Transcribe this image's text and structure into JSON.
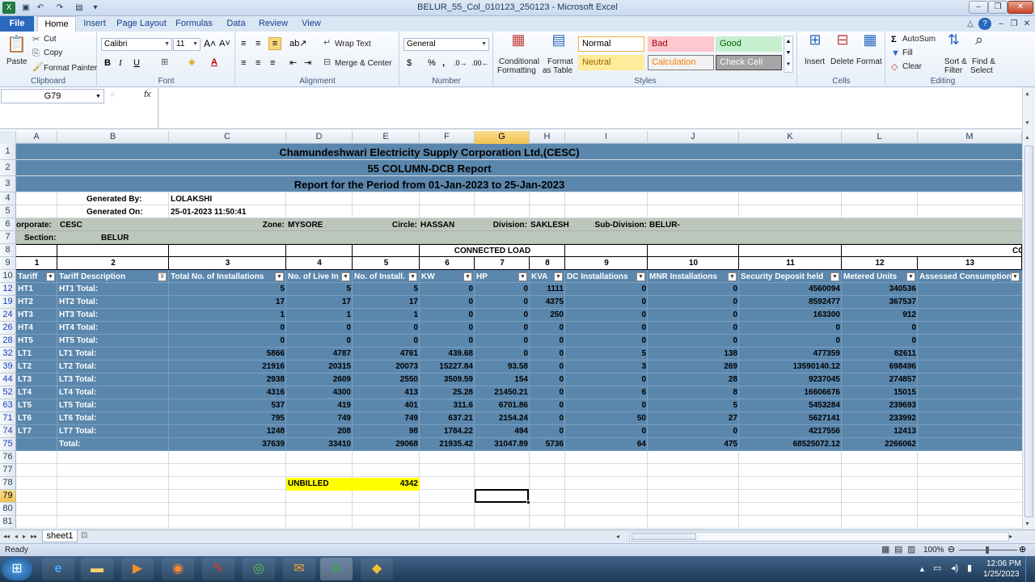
{
  "window": {
    "title": "BELUR_55_Col_010123_250123 - Microsoft Excel"
  },
  "tabs": [
    "File",
    "Home",
    "Insert",
    "Page Layout",
    "Formulas",
    "Data",
    "Review",
    "View"
  ],
  "ribbon": {
    "clipboard": {
      "paste": "Paste",
      "cut": "Cut",
      "copy": "Copy",
      "format_painter": "Format Painter",
      "label": "Clipboard"
    },
    "font": {
      "name": "Calibri",
      "size": "11",
      "label": "Font",
      "bold": "B",
      "italic": "I",
      "underline": "U"
    },
    "alignment": {
      "wrap": "Wrap Text",
      "merge": "Merge & Center",
      "label": "Alignment"
    },
    "number": {
      "format": "General",
      "label": "Number",
      "currency": "$",
      "percent": "%",
      "comma": ","
    },
    "styles": {
      "conditional": "Conditional",
      "conditional2": "Formatting",
      "format_table": "Format",
      "format_table2": "as Table",
      "label": "Styles",
      "cells": [
        {
          "name": "Normal",
          "bg": "#ffffff",
          "fg": "#000000",
          "border": "#f5b041"
        },
        {
          "name": "Bad",
          "bg": "#ffc7ce",
          "fg": "#9c0006",
          "border": "#ffc7ce"
        },
        {
          "name": "Good",
          "bg": "#c6efce",
          "fg": "#006100",
          "border": "#c6efce"
        },
        {
          "name": "Neutral",
          "bg": "#ffeb9c",
          "fg": "#9c6500",
          "border": "#ffeb9c"
        },
        {
          "name": "Calculation",
          "bg": "#f2f2f2",
          "fg": "#fa7d00",
          "border": "#7f7f7f"
        },
        {
          "name": "Check Cell",
          "bg": "#a5a5a5",
          "fg": "#ffffff",
          "border": "#3f3f3f"
        }
      ]
    },
    "cells": {
      "insert": "Insert",
      "delete": "Delete",
      "format": "Format",
      "label": "Cells"
    },
    "editing": {
      "autosum": "AutoSum",
      "fill": "Fill",
      "clear": "Clear",
      "sort": "Sort &",
      "sort2": "Filter",
      "find": "Find &",
      "find2": "Select",
      "label": "Editing"
    }
  },
  "formula_bar": {
    "name_box": "G79",
    "fx": "fx",
    "value": ""
  },
  "columns": [
    "A",
    "B",
    "C",
    "D",
    "E",
    "F",
    "G",
    "H",
    "I",
    "J",
    "K",
    "L",
    "M"
  ],
  "selected_column": "G",
  "selected_row": "79",
  "report": {
    "title1": "Chamundeshwari Electricity Supply Corporation Ltd,(CESC)",
    "title2": "55 COLUMN-DCB Report",
    "title3": "Report for the Period from 01-Jan-2023 to 25-Jan-2023",
    "generated_by_label": "Generated By:",
    "generated_by": "LOLAKSHI",
    "generated_on_label": "Generated On:",
    "generated_on": "25-01-2023 11:50:41",
    "corporate_label": "orporate:",
    "corporate": "CESC",
    "zone_label": "Zone:",
    "zone": "MYSORE",
    "circle_label": "Circle:",
    "circle": "HASSAN",
    "division_label": "Division:",
    "division": "SAKLESH",
    "subdiv_label": "Sub-Division:",
    "subdiv": "BELUR-",
    "section_label": "Section:",
    "section": "BELUR",
    "connected_load": "CONNECTED LOAD",
    "cc": "CC",
    "col_numbers": [
      "1",
      "2",
      "3",
      "4",
      "5",
      "6",
      "7",
      "8",
      "9",
      "10",
      "11",
      "12",
      "13"
    ],
    "headers": [
      "Tariff",
      "Tariff Description",
      "Total No. of  Installations",
      "No. of Live In",
      "No. of Install.",
      "KW",
      "HP",
      "KVA",
      "DC  Installations",
      "MNR  Installations",
      "Security Deposit held",
      "Metered Units",
      "Assessed Consumption"
    ],
    "unbilled_label": "UNBILLED",
    "unbilled_value": "4342"
  },
  "rows": [
    {
      "r": "12",
      "tariff": "HT1",
      "desc": "HT1 Total:",
      "c": "5",
      "d": "5",
      "e": "5",
      "f": "0",
      "g": "0",
      "h": "1111",
      "i": "0",
      "j": "0",
      "k": "4560094",
      "l": "340536"
    },
    {
      "r": "19",
      "tariff": "HT2",
      "desc": "HT2 Total:",
      "c": "17",
      "d": "17",
      "e": "17",
      "f": "0",
      "g": "0",
      "h": "4375",
      "i": "0",
      "j": "0",
      "k": "8592477",
      "l": "367537"
    },
    {
      "r": "24",
      "tariff": "HT3",
      "desc": "HT3 Total:",
      "c": "1",
      "d": "1",
      "e": "1",
      "f": "0",
      "g": "0",
      "h": "250",
      "i": "0",
      "j": "0",
      "k": "163300",
      "l": "912"
    },
    {
      "r": "26",
      "tariff": "HT4",
      "desc": "HT4 Total:",
      "c": "0",
      "d": "0",
      "e": "0",
      "f": "0",
      "g": "0",
      "h": "0",
      "i": "0",
      "j": "0",
      "k": "0",
      "l": "0"
    },
    {
      "r": "28",
      "tariff": "HT5",
      "desc": "HT5 Total:",
      "c": "0",
      "d": "0",
      "e": "0",
      "f": "0",
      "g": "0",
      "h": "0",
      "i": "0",
      "j": "0",
      "k": "0",
      "l": "0"
    },
    {
      "r": "32",
      "tariff": "LT1",
      "desc": "LT1 Total:",
      "c": "5866",
      "d": "4787",
      "e": "4761",
      "f": "439.68",
      "g": "0",
      "h": "0",
      "i": "5",
      "j": "138",
      "k": "477359",
      "l": "82611"
    },
    {
      "r": "39",
      "tariff": "LT2",
      "desc": "LT2 Total:",
      "c": "21916",
      "d": "20315",
      "e": "20073",
      "f": "15227.84",
      "g": "93.58",
      "h": "0",
      "i": "3",
      "j": "269",
      "k": "13590140.12",
      "l": "698496"
    },
    {
      "r": "44",
      "tariff": "LT3",
      "desc": "LT3 Total:",
      "c": "2938",
      "d": "2609",
      "e": "2550",
      "f": "3509.59",
      "g": "154",
      "h": "0",
      "i": "0",
      "j": "28",
      "k": "9237045",
      "l": "274857"
    },
    {
      "r": "52",
      "tariff": "LT4",
      "desc": "LT4 Total:",
      "c": "4316",
      "d": "4300",
      "e": "413",
      "f": "25.28",
      "g": "21450.21",
      "h": "0",
      "i": "6",
      "j": "8",
      "k": "16606676",
      "l": "15015"
    },
    {
      "r": "63",
      "tariff": "LT5",
      "desc": "LT5 Total:",
      "c": "537",
      "d": "419",
      "e": "401",
      "f": "311.6",
      "g": "6701.86",
      "h": "0",
      "i": "0",
      "j": "5",
      "k": "5453284",
      "l": "239693"
    },
    {
      "r": "71",
      "tariff": "LT6",
      "desc": "LT6 Total:",
      "c": "795",
      "d": "749",
      "e": "749",
      "f": "637.21",
      "g": "2154.24",
      "h": "0",
      "i": "50",
      "j": "27",
      "k": "5627141",
      "l": "233992"
    },
    {
      "r": "74",
      "tariff": "LT7",
      "desc": "LT7 Total:",
      "c": "1248",
      "d": "208",
      "e": "98",
      "f": "1784.22",
      "g": "494",
      "h": "0",
      "i": "0",
      "j": "0",
      "k": "4217556",
      "l": "12413"
    },
    {
      "r": "75",
      "tariff": "",
      "desc": "Total:",
      "c": "37639",
      "d": "33410",
      "e": "29068",
      "f": "21935.42",
      "g": "31047.89",
      "h": "5736",
      "i": "64",
      "j": "475",
      "k": "68525072.12",
      "l": "2266062"
    }
  ],
  "row_numbers_top": [
    "1",
    "2",
    "3",
    "4",
    "5",
    "6",
    "7",
    "8",
    "9",
    "10"
  ],
  "row_numbers_bottom": [
    "76",
    "77",
    "78",
    "79",
    "80",
    "81"
  ],
  "sheet": {
    "name": "sheet1"
  },
  "status": {
    "ready": "Ready",
    "zoom": "100%"
  },
  "clock": {
    "time": "12:06 PM",
    "date": "1/25/2023"
  }
}
